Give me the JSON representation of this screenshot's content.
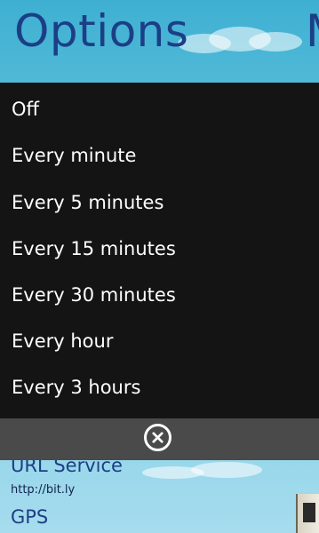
{
  "background": {
    "title": "Options",
    "title_next": "M",
    "section1_title": "URL Service",
    "section1_value": "http://bit.ly",
    "section2_title": "GPS"
  },
  "picker": {
    "options": [
      "Off",
      "Every minute",
      "Every 5 minutes",
      "Every 15 minutes",
      "Every 30 minutes",
      "Every hour",
      "Every 3 hours"
    ]
  },
  "appbar": {
    "close_icon": "close-icon"
  },
  "colors": {
    "picker_bg": "#141414",
    "appbar_bg": "#4a4a4a",
    "title_color": "#1b3f86",
    "text": "#ffffff"
  }
}
